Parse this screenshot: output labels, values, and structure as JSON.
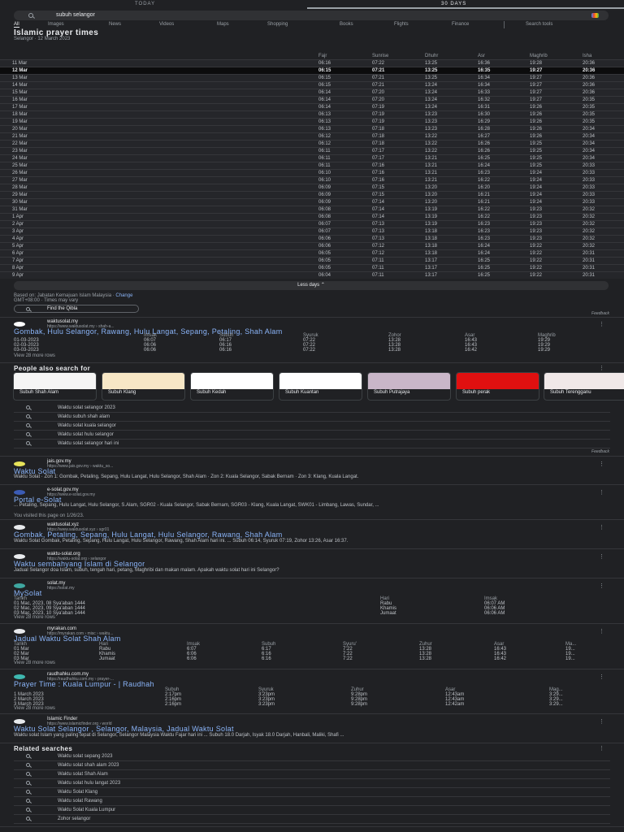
{
  "tabs": {
    "today": "TODAY",
    "days30": "30 DAYS"
  },
  "search": {
    "query": "subuh selangor"
  },
  "nav": [
    "All",
    "Images",
    "News",
    "Videos",
    "Maps",
    "Shopping",
    "Books",
    "Flights",
    "Finance"
  ],
  "nav_tools": "Search tools",
  "prayer": {
    "title": "Islamic prayer times",
    "subtitle": "Selangor · 12 March 2023",
    "columns": [
      "",
      "Fajr",
      "Sunrise",
      "Dhuhr",
      "Asr",
      "Maghrib",
      "Isha"
    ],
    "highlight": "12 Mar",
    "rows": [
      [
        "11 Mar",
        "06:16",
        "07:22",
        "13:25",
        "16:36",
        "19:28",
        "20:36"
      ],
      [
        "12 Mar",
        "06:15",
        "07:21",
        "13:25",
        "16:35",
        "19:27",
        "20:36"
      ],
      [
        "13 Mar",
        "06:15",
        "07:21",
        "13:25",
        "16:34",
        "19:27",
        "20:36"
      ],
      [
        "14 Mar",
        "06:15",
        "07:21",
        "13:24",
        "16:34",
        "19:27",
        "20:36"
      ],
      [
        "15 Mar",
        "06:14",
        "07:20",
        "13:24",
        "16:33",
        "19:27",
        "20:36"
      ],
      [
        "16 Mar",
        "06:14",
        "07:20",
        "13:24",
        "16:32",
        "19:27",
        "20:35"
      ],
      [
        "17 Mar",
        "06:14",
        "07:19",
        "13:24",
        "16:31",
        "19:26",
        "20:35"
      ],
      [
        "18 Mar",
        "06:13",
        "07:19",
        "13:23",
        "16:30",
        "19:26",
        "20:35"
      ],
      [
        "19 Mar",
        "06:13",
        "07:19",
        "13:23",
        "16:29",
        "19:26",
        "20:35"
      ],
      [
        "20 Mar",
        "06:13",
        "07:18",
        "13:23",
        "16:28",
        "19:26",
        "20:34"
      ],
      [
        "21 Mar",
        "06:12",
        "07:18",
        "13:22",
        "16:27",
        "19:26",
        "20:34"
      ],
      [
        "22 Mar",
        "06:12",
        "07:18",
        "13:22",
        "16:26",
        "19:25",
        "20:34"
      ],
      [
        "23 Mar",
        "06:11",
        "07:17",
        "13:22",
        "16:26",
        "19:25",
        "20:34"
      ],
      [
        "24 Mar",
        "06:11",
        "07:17",
        "13:21",
        "16:25",
        "19:25",
        "20:34"
      ],
      [
        "25 Mar",
        "06:11",
        "07:16",
        "13:21",
        "16:24",
        "19:25",
        "20:33"
      ],
      [
        "26 Mar",
        "06:10",
        "07:16",
        "13:21",
        "16:23",
        "19:24",
        "20:33"
      ],
      [
        "27 Mar",
        "06:10",
        "07:16",
        "13:21",
        "16:22",
        "19:24",
        "20:33"
      ],
      [
        "28 Mar",
        "06:09",
        "07:15",
        "13:20",
        "16:20",
        "19:24",
        "20:33"
      ],
      [
        "29 Mar",
        "06:09",
        "07:15",
        "13:20",
        "16:21",
        "19:24",
        "20:33"
      ],
      [
        "30 Mar",
        "06:09",
        "07:14",
        "13:20",
        "16:21",
        "19:24",
        "20:33"
      ],
      [
        "31 Mar",
        "06:08",
        "07:14",
        "13:19",
        "16:22",
        "19:23",
        "20:32"
      ],
      [
        "1 Apr",
        "06:08",
        "07:14",
        "13:19",
        "16:22",
        "19:23",
        "20:32"
      ],
      [
        "2 Apr",
        "06:07",
        "07:13",
        "13:19",
        "16:23",
        "19:23",
        "20:32"
      ],
      [
        "3 Apr",
        "06:07",
        "07:13",
        "13:18",
        "16:23",
        "19:23",
        "20:32"
      ],
      [
        "4 Apr",
        "06:06",
        "07:13",
        "13:18",
        "16:23",
        "19:23",
        "20:32"
      ],
      [
        "5 Apr",
        "06:06",
        "07:12",
        "13:18",
        "16:24",
        "19:22",
        "20:32"
      ],
      [
        "6 Apr",
        "06:05",
        "07:12",
        "13:18",
        "16:24",
        "19:22",
        "20:31"
      ],
      [
        "7 Apr",
        "06:05",
        "07:11",
        "13:17",
        "16:25",
        "19:22",
        "20:31"
      ],
      [
        "8 Apr",
        "06:05",
        "07:11",
        "13:17",
        "16:25",
        "19:22",
        "20:31"
      ],
      [
        "9 Apr",
        "06:04",
        "07:11",
        "13:17",
        "16:25",
        "19:22",
        "20:31"
      ]
    ],
    "less_days": "Less days  ⌃",
    "source": "Based on: Jabatan Kemajuan Islam Malaysia · ",
    "change": "Change",
    "gmt": "GMT+08:00 · Times may vary",
    "qibla": "Find the Qibla",
    "feedback": "Feedback"
  },
  "r1": {
    "site": "waktusolat.my",
    "url": "https://www.waktusolat.my › shah-a...",
    "title": "Gombak, Hulu Selangor, Rawang, Hulu Langat, Sepang, Petaling, Shah Alam",
    "table": [
      [
        "",
        "Imsak",
        "Subuh",
        "Syuruk",
        "Zohor",
        "Asar",
        "Maghrib"
      ],
      [
        "01-03-2023",
        "06:07",
        "06:17",
        "07:22",
        "13:28",
        "16:43",
        "19:29"
      ],
      [
        "02-03-2023",
        "06:06",
        "06:16",
        "07:22",
        "13:28",
        "16:43",
        "19:29"
      ],
      [
        "03-03-2023",
        "06:06",
        "06:16",
        "07:22",
        "13:28",
        "16:42",
        "19:29"
      ]
    ],
    "more": "View 28 more rows"
  },
  "pasf": {
    "heading": "People also search for",
    "cards": [
      "Subuh Shah Alam",
      "Subuh Klang",
      "Subuh Kedah",
      "Subuh Kuantan",
      "Subuh Putrajaya",
      "Subuh perak",
      "Subuh Terengganu"
    ],
    "items": [
      "Waktu solat selangor 2023",
      "Waktu subuh shah alam",
      "Waktu solat kuala selangor",
      "Waktu solat hulu selangor",
      "Waktu solat selangor hari ini"
    ],
    "feedback": "Feedback"
  },
  "r2": {
    "site": "jais.gov.my",
    "url": "https://www.jais.gov.my › waktu_so...",
    "title": "Waktu Solat",
    "snippet": "Waktu Solat · Zon 1: Gombak, Petaling, Sepang, Hulu Langat, Hulu Selangor, Shah Alam · Zon 2: Kuala Selangor, Sabak Bernam · Zon 3: Klang, Kuala Langat."
  },
  "r3": {
    "site": "e-solat.gov.my",
    "url": "https://www.e-solat.gov.my",
    "title": "Portal e-Solat",
    "snippet": "... Petaling, Sepang, Hulu Langat, Hulu Selangor, S.Alam, SGR02 - Kuala Selangor, Sabak Bernam, SGR03 - Klang, Kuala Langat, SWK01 - Limbang, Lawas, Sundar, ...",
    "visited": "You visited this page on 1/26/23."
  },
  "r4": {
    "site": "waktusolat.xyz",
    "url": "https://www.waktusolat.xyz › sgr01",
    "title": "Gombak, Petaling, Sepang, Hulu Langat, Hulu Selangor, Rawang, Shah Alam",
    "snippet": "Waktu Solat Gombak, Petaling, Sepang, Hulu Langat, Hulu Selangor, Rawang, Shah Alam hari ini. ... Subuh 06:14, Syuruk 07:19, Zohor 13:26, Asar 16:37."
  },
  "r5": {
    "site": "waktu-solat.org",
    "url": "https://waktu-solat.org › selangor",
    "title": "Waktu sembahyang Islam di Selangor",
    "snippet": "Jadual Selangor doa Islam, subuh, tengah hari, petang, Maghribi dan makan malam. Apakah waktu solat hari ini Selangor?"
  },
  "r6": {
    "site": "solat.my",
    "url": "https://solat.my",
    "title": "MySolat",
    "table": [
      [
        "Tarikh",
        "Hari",
        "Imsak"
      ],
      [
        "01 Mac, 2023, 08 Sya'aban 1444",
        "Rabu",
        "06:07 AM"
      ],
      [
        "02 Mac, 2023, 09 Sya'aban 1444",
        "Khamis",
        "06:06 AM"
      ],
      [
        "03 Mac, 2023, 10 Sya'aban 1444",
        "Jumaat",
        "06:06 AM"
      ]
    ],
    "more": "View 28 more rows"
  },
  "r7": {
    "site": "myrakan.com",
    "url": "https://myrakan.com › misc › waktu...",
    "title": "Jadual Waktu Solat Shah Alam",
    "table": [
      [
        "Tarikh",
        "Hari",
        "Imsak",
        "Subuh",
        "Syuru'",
        "Zuhur",
        "Asar",
        "Ma..."
      ],
      [
        "01 Mar",
        "Rabu",
        "6:07",
        "6:17",
        "7:22",
        "13:28",
        "16:43",
        "19..."
      ],
      [
        "02 Mar",
        "Khamis",
        "6:06",
        "6:16",
        "7:22",
        "13:28",
        "16:43",
        "19..."
      ],
      [
        "03 Mar",
        "Jumaat",
        "6:06",
        "6:16",
        "7:22",
        "13:28",
        "16:42",
        "19..."
      ]
    ],
    "more": "View 28 more rows"
  },
  "r8": {
    "site": "raudhahku.com.my",
    "url": "https://raudhahku.com.my › prayer-...",
    "title": "Prayer Time : Kuala Lumpur - | Raudhah",
    "table": [
      [
        "",
        "Subuh",
        "Syuruk",
        "Zuhur",
        "Asar",
        "Mag..."
      ],
      [
        "1 March 2023",
        "2:17pm",
        "3:23pm",
        "9:28pm",
        "12:43am",
        "3:29..."
      ],
      [
        "2 March 2023",
        "2:16pm",
        "3:23pm",
        "9:28pm",
        "12:43am",
        "3:29..."
      ],
      [
        "3 March 2023",
        "2:16pm",
        "3:23pm",
        "9:28pm",
        "12:42am",
        "3:29..."
      ]
    ],
    "more": "View 28 more rows"
  },
  "r9": {
    "site": "Islamic Finder",
    "url": "https://www.islamicfinder.org › world",
    "title": "Waktu Solat Selangor , Selangor, Malaysia, Jadual Waktu Solat",
    "snippet": "Waktu solat Islam yang paling tepat di Selangor, Selangor Malaysia Waktu Fajar hari ini ... Subuh 18.0 Darjah, Isyak 18.0 Darjah, Hanbali, Maliki, Shafi ..."
  },
  "related": {
    "heading": "Related searches",
    "items": [
      "Waktu solat sepang 2023",
      "Waktu solat shah alam 2023",
      "Waktu solat Shah Alam",
      "Waktu solat hulu langat 2023",
      "Waktu Solat Klang",
      "Waktu solat Rawang",
      "Waktu Solat Kuala Lumpur",
      "Zohor selangor"
    ]
  },
  "colors": {
    "bg": "#202124",
    "link": "#8ab4f8",
    "text": "#bdc1c6"
  }
}
